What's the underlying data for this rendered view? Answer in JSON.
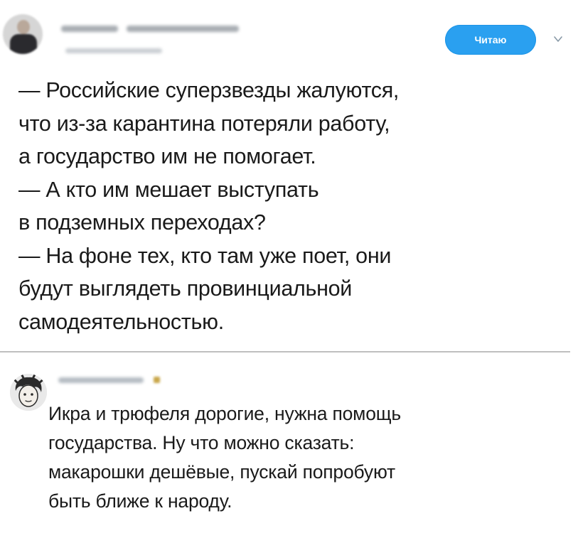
{
  "tweet": {
    "follow_button_label": "Читаю",
    "text_lines": [
      "— Российские суперзвезды жалуются,",
      "что из-за карантина потеряли работу,",
      "а государство им не помогает.",
      "— А кто им мешает выступать",
      "в подземных переходах?",
      "— На фоне тех, кто там уже поет, они",
      "будут выглядеть провинциальной",
      "самодеятельностью."
    ]
  },
  "reply": {
    "text_lines": [
      "Икра и трюфеля дорогие, нужна помощь",
      "государства. Ну что можно сказать:",
      "макарошки дешёвые, пускай попробуют",
      "быть ближе к народу."
    ]
  },
  "icons": {
    "chevron": "chevron-down-icon",
    "main_avatar": "avatar",
    "reply_avatar": "avatar"
  },
  "colors": {
    "follow_button": "#2aa0f0",
    "text": "#1a1a1a",
    "divider": "#bfbfbf"
  }
}
